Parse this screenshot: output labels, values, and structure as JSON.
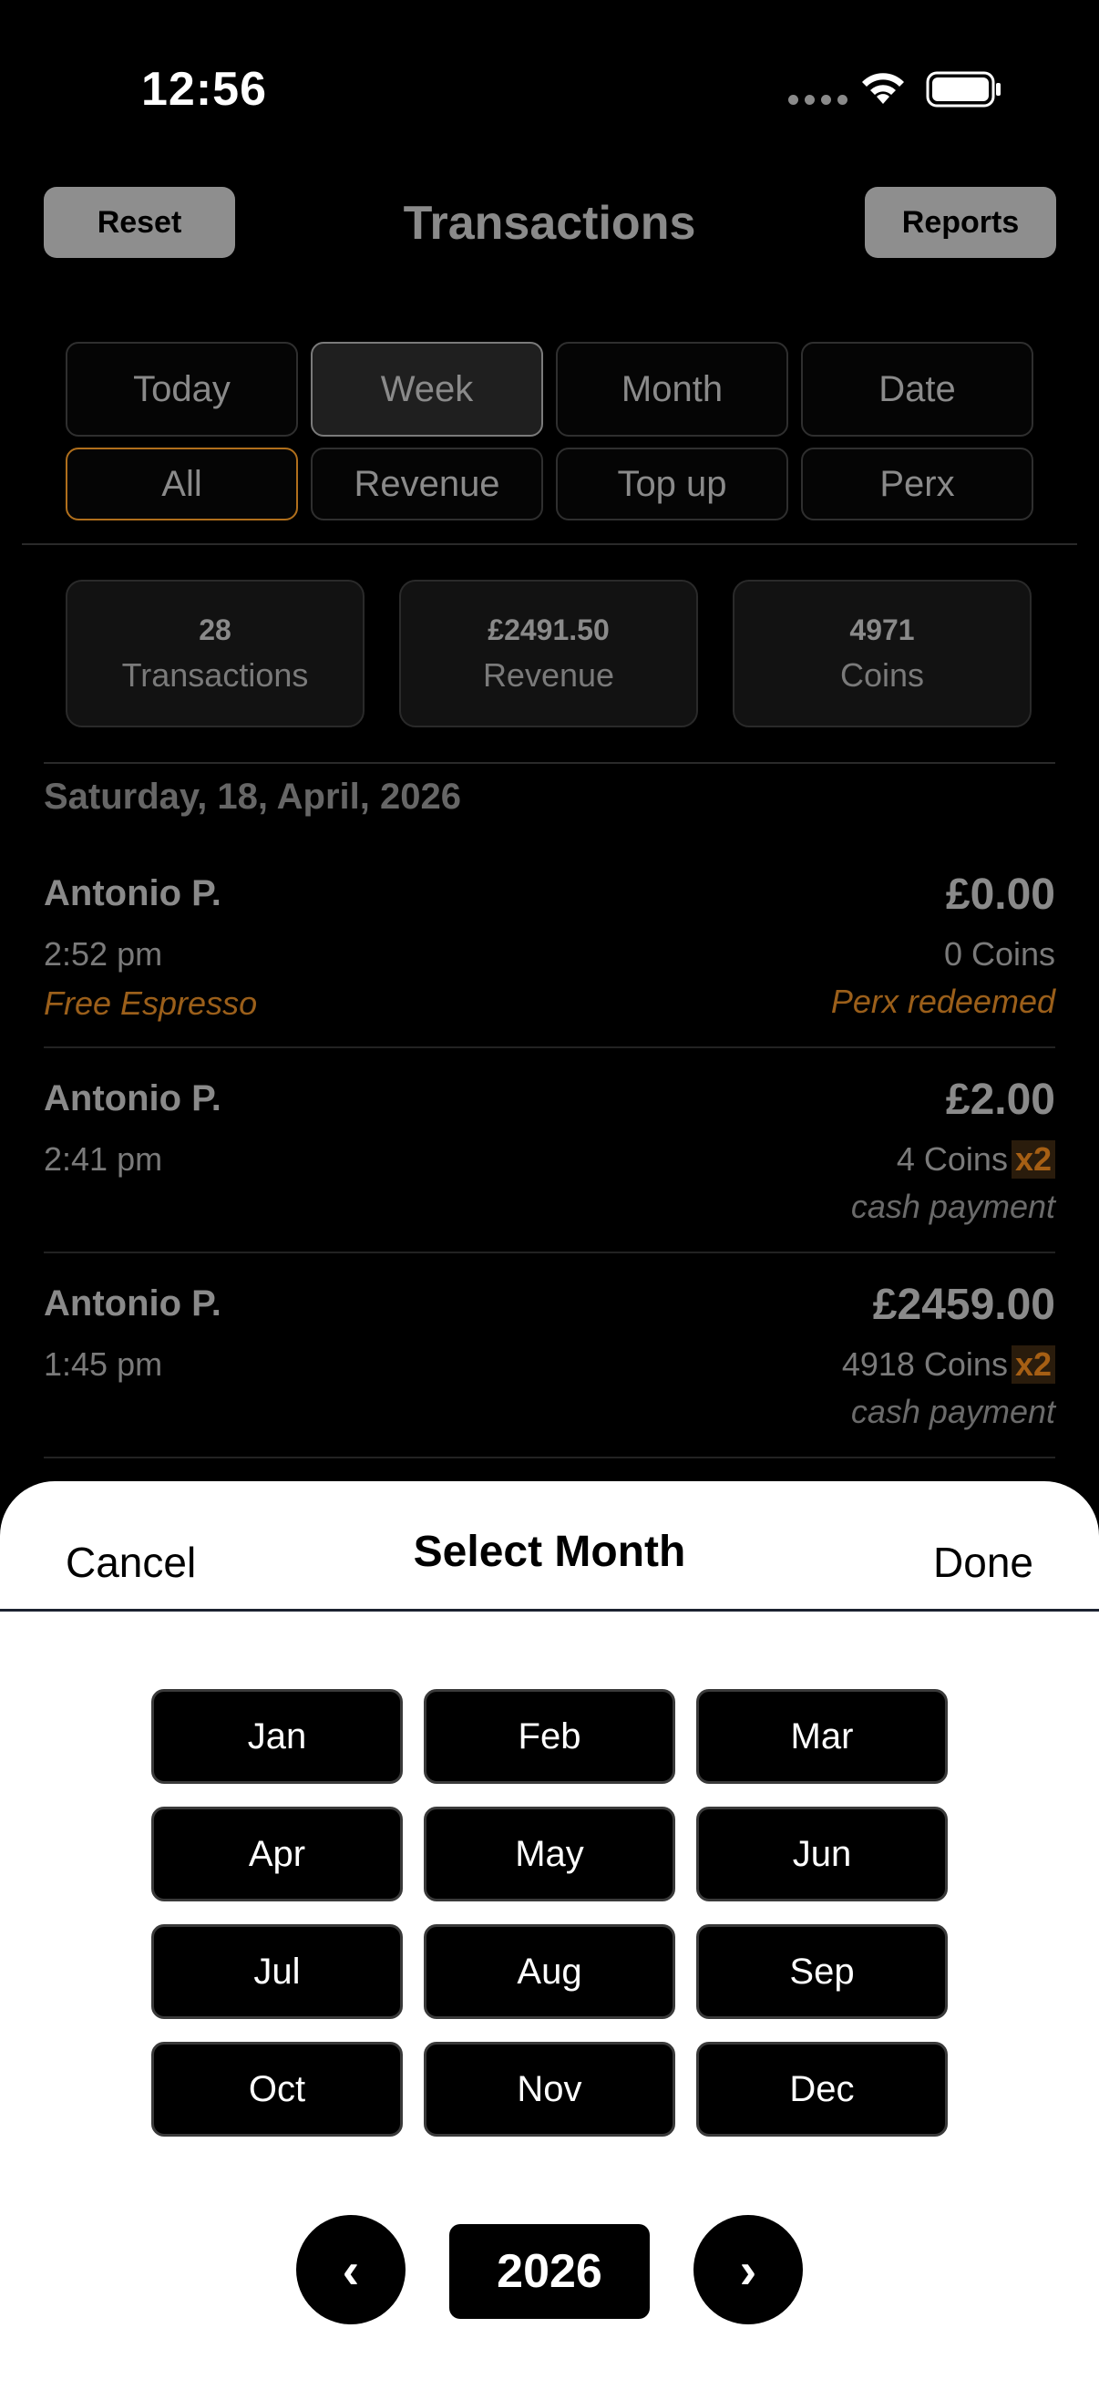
{
  "status_bar": {
    "time": "12:56",
    "wifi_icon": "wifi-icon",
    "battery_icon": "battery-icon"
  },
  "header": {
    "title": "Transactions",
    "reset_label": "Reset",
    "reports_label": "Reports"
  },
  "period_filters": [
    "Today",
    "Week",
    "Month",
    "Date"
  ],
  "type_filters": [
    "All",
    "Revenue",
    "Top up",
    "Perx"
  ],
  "selected_period": "Week",
  "selected_type": "All",
  "summary": {
    "transactions": {
      "value": "28",
      "label": "Transactions"
    },
    "revenue": {
      "value": "£2491.50",
      "label": "Revenue"
    },
    "coins": {
      "value": "4971",
      "label": "Coins"
    }
  },
  "list": {
    "date_header": "Saturday, 18, April, 2026",
    "transactions": [
      {
        "name": "Antonio P.",
        "time": "2:52 pm",
        "note": "Free Espresso",
        "amount": "£0.00",
        "coins": "0 Coins",
        "multiplier": "",
        "status": "Perx redeemed"
      },
      {
        "name": "Antonio P.",
        "time": "2:41 pm",
        "note": "",
        "amount": "£2.00",
        "coins": "4 Coins",
        "multiplier": "x2",
        "status": "cash payment"
      },
      {
        "name": "Antonio P.",
        "time": "1:45 pm",
        "note": "",
        "amount": "£2459.00",
        "coins": "4918 Coins",
        "multiplier": "x2",
        "status": "cash payment"
      }
    ]
  },
  "month_picker": {
    "title": "Select Month",
    "cancel_label": "Cancel",
    "done_label": "Done",
    "months": [
      "Jan",
      "Feb",
      "Mar",
      "Apr",
      "May",
      "Jun",
      "Jul",
      "Aug",
      "Sep",
      "Oct",
      "Nov",
      "Dec"
    ],
    "year": "2026",
    "prev_label": "‹",
    "next_label": "›"
  },
  "colors": {
    "accent_orange": "#b06f1c",
    "sheet_bg": "#ffffff",
    "app_bg": "#000000"
  }
}
